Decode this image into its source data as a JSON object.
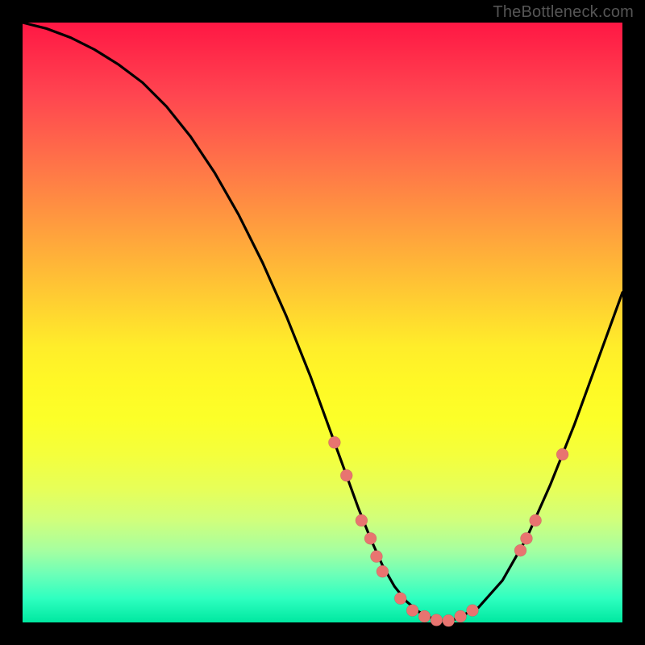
{
  "watermark": "TheBottleneck.com",
  "colors": {
    "background": "#000000",
    "gradient_top": "#ff1744",
    "gradient_bottom": "#00e8a0",
    "curve": "#000000",
    "dot": "#e87470"
  },
  "chart_data": {
    "type": "line",
    "title": "",
    "xlabel": "",
    "ylabel": "",
    "xlim": [
      0,
      100
    ],
    "ylim": [
      0,
      100
    ],
    "series": [
      {
        "name": "curve",
        "x": [
          0,
          4,
          8,
          12,
          16,
          20,
          24,
          28,
          32,
          36,
          40,
          44,
          48,
          50,
          52,
          54,
          56,
          58,
          60,
          62,
          64,
          66,
          68,
          70,
          72,
          76,
          80,
          84,
          88,
          92,
          96,
          100
        ],
        "values": [
          100,
          99,
          97.5,
          95.5,
          93,
          90,
          86,
          81,
          75,
          68,
          60,
          51,
          41,
          35.5,
          30,
          24.5,
          19,
          14,
          9.5,
          6,
          3.5,
          1.8,
          0.8,
          0.3,
          0.5,
          2.5,
          7,
          14,
          23,
          33,
          44,
          55
        ]
      }
    ],
    "markers": [
      {
        "x": 52,
        "y": 30
      },
      {
        "x": 54,
        "y": 24.5
      },
      {
        "x": 56.5,
        "y": 17
      },
      {
        "x": 58,
        "y": 14
      },
      {
        "x": 59,
        "y": 11
      },
      {
        "x": 60,
        "y": 8.5
      },
      {
        "x": 63,
        "y": 4
      },
      {
        "x": 65,
        "y": 2
      },
      {
        "x": 67,
        "y": 1
      },
      {
        "x": 69,
        "y": 0.4
      },
      {
        "x": 71,
        "y": 0.3
      },
      {
        "x": 73,
        "y": 1
      },
      {
        "x": 75,
        "y": 2
      },
      {
        "x": 83,
        "y": 12
      },
      {
        "x": 84,
        "y": 14
      },
      {
        "x": 85.5,
        "y": 17
      },
      {
        "x": 90,
        "y": 28
      }
    ]
  }
}
